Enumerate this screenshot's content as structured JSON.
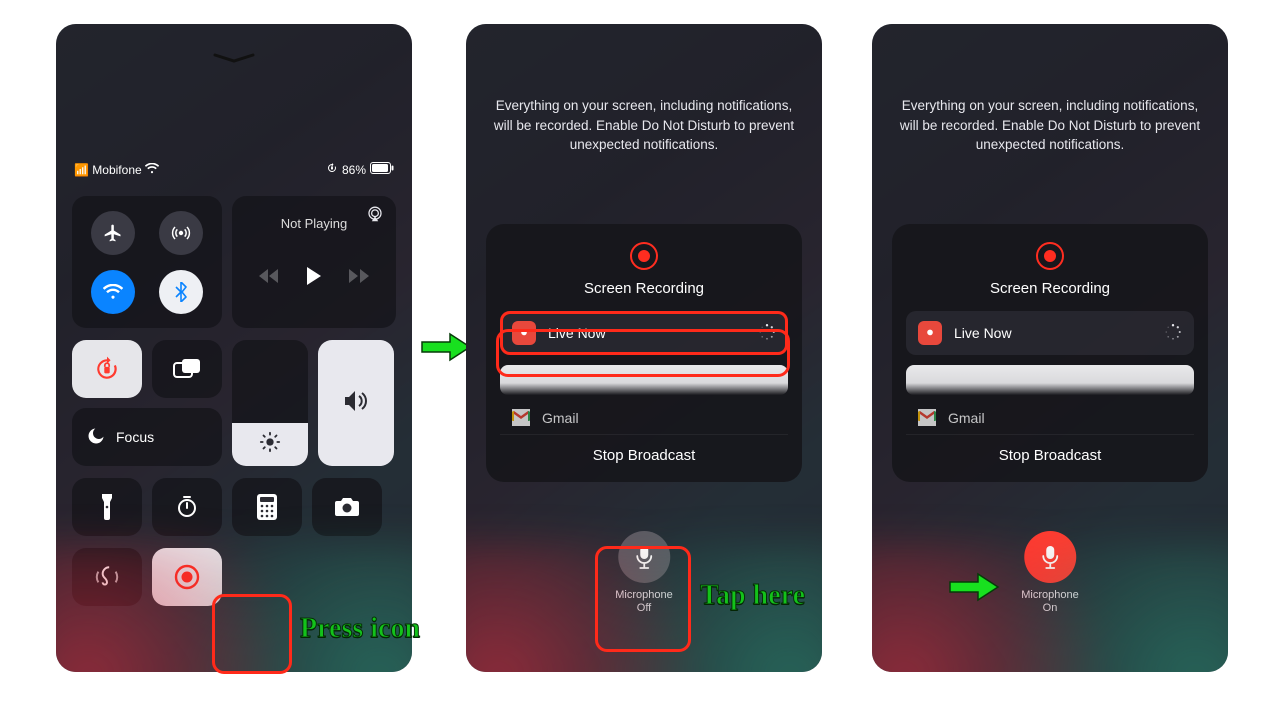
{
  "phone1": {
    "status": {
      "carrier": "Mobifone",
      "battery": "86%"
    },
    "media": {
      "not_playing": "Not Playing"
    },
    "focus_label": "Focus"
  },
  "phone2": {
    "info": "Everything on your screen, including notifications, will be recorded. Enable Do Not Disturb to prevent unexpected notifications.",
    "card": {
      "title": "Screen Recording",
      "row_live": "Live Now",
      "row_gmail": "Gmail",
      "stop": "Stop Broadcast"
    },
    "mic": {
      "label_line1": "Microphone",
      "label_line2": "Off"
    }
  },
  "phone3": {
    "info": "Everything on your screen, including notifications, will be recorded. Enable Do Not Disturb to prevent unexpected notifications.",
    "card": {
      "title": "Screen Recording",
      "row_live": "Live Now",
      "row_gmail": "Gmail",
      "stop": "Stop Broadcast"
    },
    "mic": {
      "label_line1": "Microphone",
      "label_line2": "On"
    }
  },
  "annotations": {
    "press_icon": "Press icon",
    "tap_here": "Tap here"
  }
}
